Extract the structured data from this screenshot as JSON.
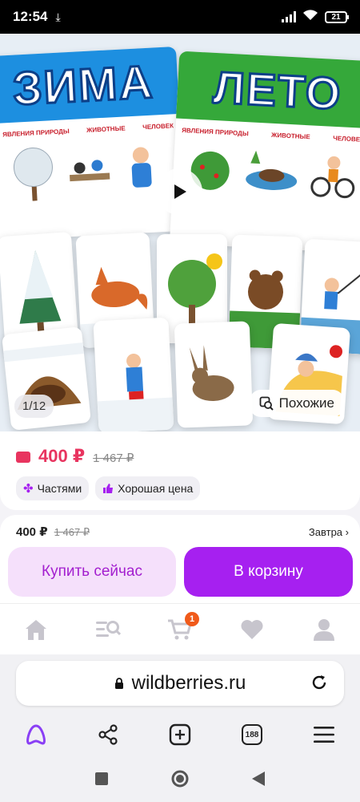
{
  "status_bar": {
    "time": "12:54",
    "battery": "21"
  },
  "gallery": {
    "counter": "1/12",
    "similar_label": "Похожие",
    "image_text": {
      "winter_title": "ЗИМА",
      "summer_title": "ЛЕТО",
      "winter_columns": [
        "ЯВЛЕНИЯ ПРИРОДЫ",
        "ЖИВОТНЫЕ",
        "ЧЕЛОВЕК"
      ],
      "summer_columns": [
        "ЯВЛЕНИЯ ПРИРОДЫ",
        "ЖИВОТНЫЕ",
        "ЧЕЛОВЕК"
      ]
    }
  },
  "product": {
    "price": "400 ₽",
    "old_price": "1 467 ₽",
    "chips": [
      {
        "label": "Частями",
        "icon": "parts-icon"
      },
      {
        "label": "Хорошая цена",
        "icon": "thumbs-up-icon"
      }
    ]
  },
  "buy_bar": {
    "price": "400 ₽",
    "old_price": "1 467 ₽",
    "delivery": "Завтра",
    "buy_now": "Купить сейчас",
    "add_to_cart": "В корзину"
  },
  "tab_bar": {
    "items": [
      "home-icon",
      "catalog-search-icon",
      "cart-icon",
      "heart-icon",
      "profile-icon"
    ],
    "cart_badge": "1"
  },
  "browser": {
    "url": "wildberries.ru",
    "tabs_count": "188"
  },
  "colors": {
    "brand_purple": "#a620f0",
    "price_red": "#e8345f",
    "winter_blue": "#1d8fe0",
    "summer_green": "#35a83a"
  }
}
